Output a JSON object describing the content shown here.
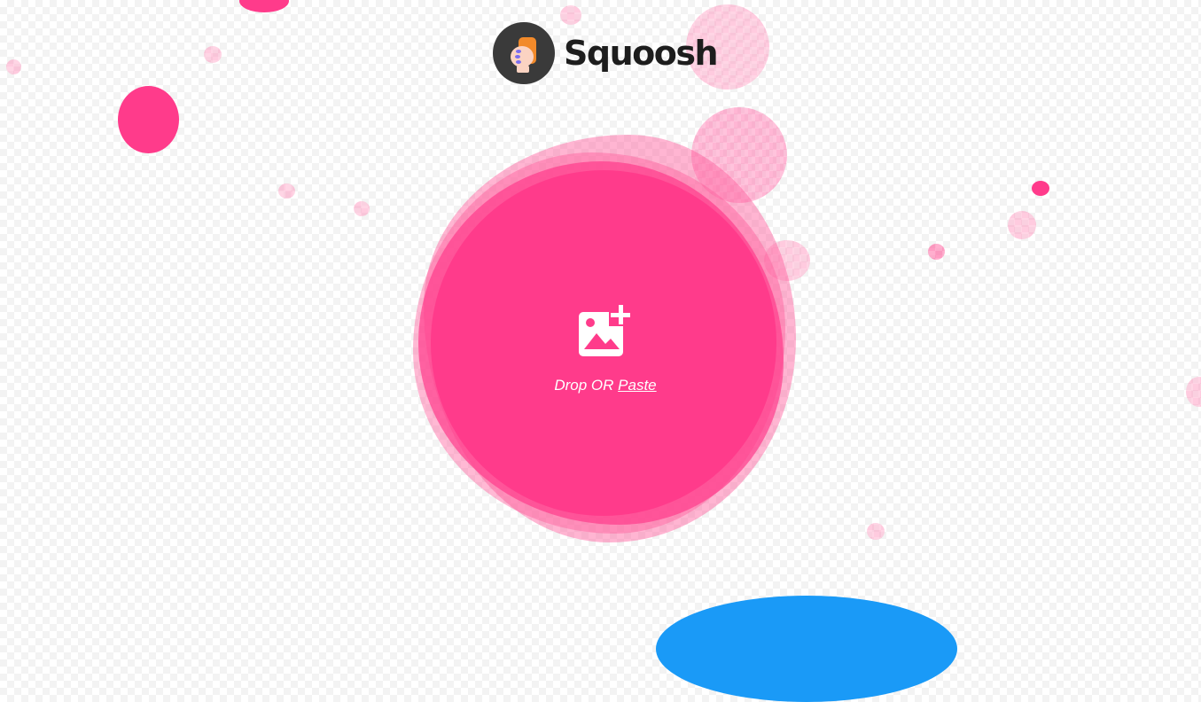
{
  "app": {
    "name": "Squoosh",
    "logo_icon": "squoosh-hand-logo-icon"
  },
  "drop_zone": {
    "icon": "add-image-icon",
    "drop_label": "Drop OR",
    "paste_label": "Paste"
  },
  "colors": {
    "accent_pink": "#ff3b8b",
    "light_pink": "#ff8cb9",
    "blue": "#1a9af7",
    "logo_bg": "#3a3a3a",
    "logo_text": "#1d1d1d"
  }
}
